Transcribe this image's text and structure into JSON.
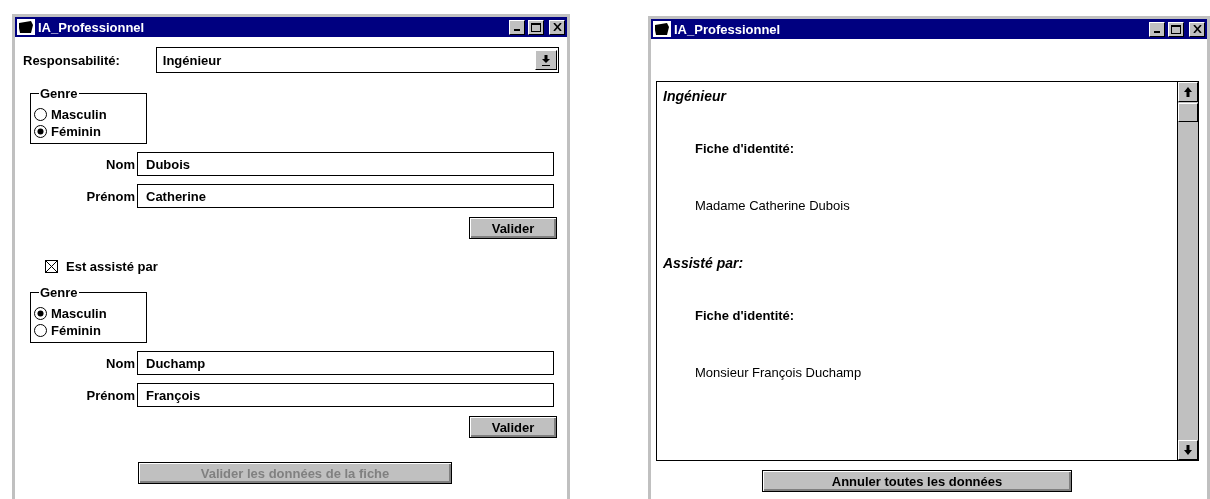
{
  "left_window": {
    "title": "IA_Professionnel",
    "responsibility": {
      "label": "Responsabilité:",
      "value": "Ingénieur"
    },
    "sections": [
      {
        "kind": "person",
        "genre": {
          "label": "Genre",
          "options": [
            {
              "label": "Masculin",
              "selected": false
            },
            {
              "label": "Féminin",
              "selected": true
            }
          ]
        },
        "fields": [
          {
            "label": "Nom",
            "value": "Dubois"
          },
          {
            "label": "Prénom",
            "value": "Catherine"
          }
        ],
        "button": "Valider"
      },
      {
        "kind": "checkbox",
        "label": "Est assisté par",
        "checked": true
      },
      {
        "kind": "person",
        "genre": {
          "label": "Genre",
          "options": [
            {
              "label": "Masculin",
              "selected": true
            },
            {
              "label": "Féminin",
              "selected": false
            }
          ]
        },
        "fields": [
          {
            "label": "Nom",
            "value": "Duchamp"
          },
          {
            "label": "Prénom",
            "value": "François"
          }
        ],
        "button": "Valider"
      }
    ],
    "submit": {
      "label": "Valider les données de la fiche",
      "disabled": true
    }
  },
  "right_window": {
    "title": "IA_Professionnel",
    "lines": [
      {
        "kind": "heading",
        "text": "Ingénieur"
      },
      {
        "kind": "subheading",
        "text": "Fiche d'identité:"
      },
      {
        "kind": "text",
        "text": "Madame Catherine Dubois"
      },
      {
        "kind": "heading",
        "text": "Assisté par:"
      },
      {
        "kind": "subheading",
        "text": "Fiche d'identité:"
      },
      {
        "kind": "text",
        "text": "Monsieur François Duchamp"
      }
    ],
    "button": {
      "label": "Annuler toutes les données",
      "disabled": false
    }
  }
}
